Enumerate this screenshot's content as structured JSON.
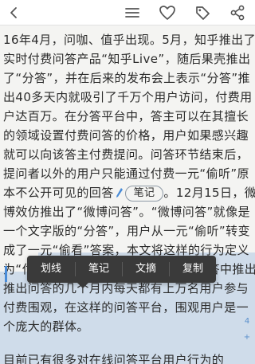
{
  "toolbar": {
    "icons": [
      "back-arrow-icon",
      "menu-icon",
      "heart-icon",
      "tag-icon",
      "share-icon"
    ]
  },
  "text_lines": [
    "16年4月，问咖、值乎出现。5月，知乎推出了",
    "实时付费问答产品“知乎Live”，随后果壳推出",
    "了“分答”，并在后来的发布会上表示“分答”推",
    "出40多天内就吸引了千万个用户访问，付费用",
    "户达百万。在分答平台中，答主可以在其擅长",
    "的领域设置付费问答的价格，用户如果感兴趣",
    "就可以向该答主付费提问。问答环节结束后，",
    "提问者以外的用户只能通过付费一元“偷听”原",
    "本不公开可见的回答",
    "。12月15日，微",
    "博效仿推出了“微博问答”。“微博问答”就像是",
    "一个文字版的“分答”，用户从一元“偷听”转变",
    "成了一元“偷看”答案，本文将这样的行为定义",
    "为“付",
    "费问答”，在同答中推出后的短期内规模，",
    "推出问答的几个月内每天都有上万名用户参与",
    "付费围观，在这样的问答平台，围观用户是一",
    "个庞大的群体。",
    "    目前已有很多对在线问答平台用户行为的"
  ],
  "note_badge": "笔记",
  "context_menu": {
    "items": [
      "划线",
      "笔记",
      "文摘",
      "复制"
    ]
  },
  "side_markers": [
    "4",
    "+"
  ]
}
